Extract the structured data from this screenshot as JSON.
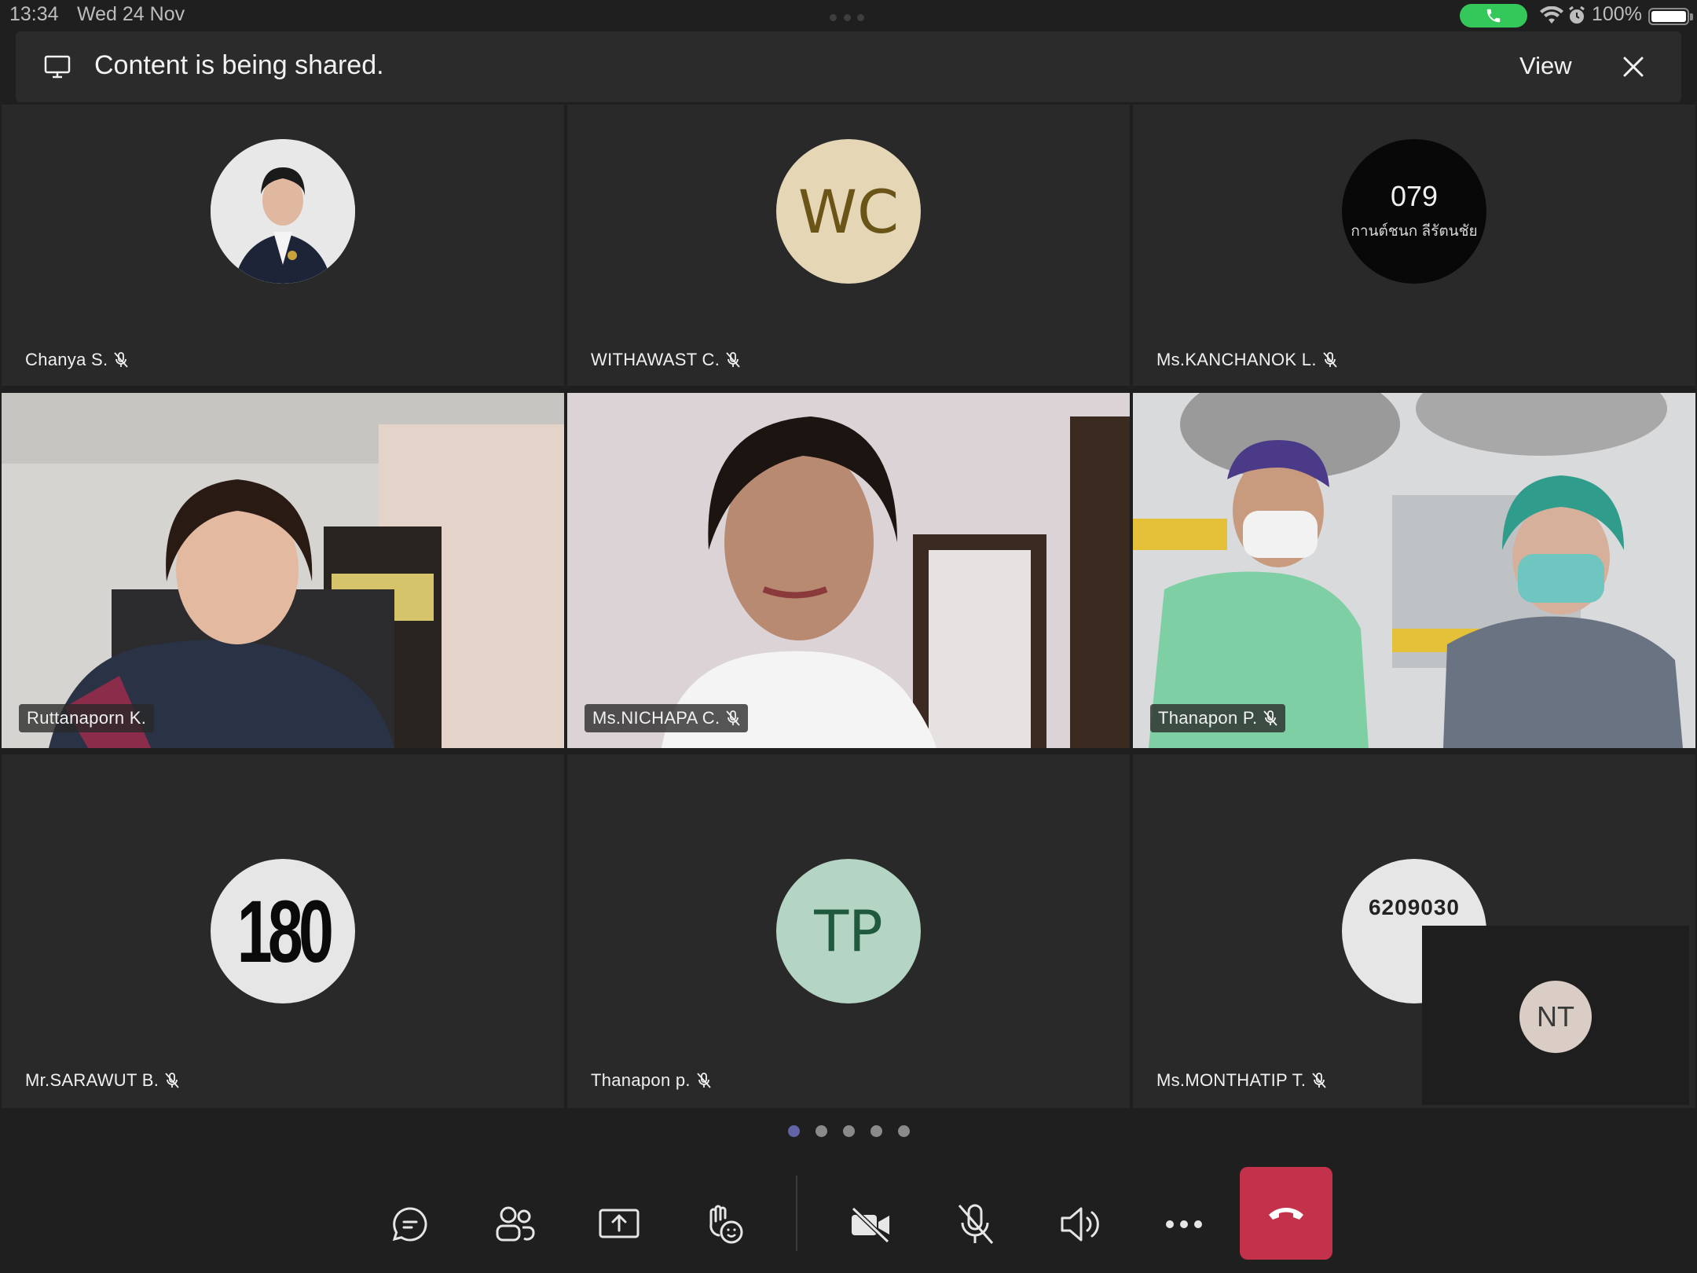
{
  "status_bar": {
    "time": "13:34",
    "date": "Wed 24 Nov",
    "battery": "100%"
  },
  "banner": {
    "text": "Content is being shared.",
    "view_label": "View",
    "icon": "monitor-icon"
  },
  "participants": [
    {
      "name": "Chanya S.",
      "avatar": "photo",
      "muted": true
    },
    {
      "name": "WITHAWAST C.",
      "initials": "WC",
      "muted": true
    },
    {
      "name": "Ms.KANCHANOK L.",
      "avatar_line1": "079",
      "avatar_line2": "กานต์ชนก ลีรัตนชัย",
      "muted": true
    },
    {
      "name": "Ruttanaporn K.",
      "video": true,
      "speaking": true,
      "muted": false
    },
    {
      "name": "Ms.NICHAPA C.",
      "video": true,
      "speaking": true,
      "muted": true
    },
    {
      "name": "Thanapon P.",
      "video": true,
      "muted": true
    },
    {
      "name": "Mr.SARAWUT B.",
      "avatar_text": "180",
      "muted": true
    },
    {
      "name": "Thanapon p.",
      "initials": "TP",
      "muted": true
    },
    {
      "name": "Ms.MONTHATIP T.",
      "avatar_text": "6209030",
      "muted": true
    }
  ],
  "self_view": {
    "initials": "NT"
  },
  "pager": {
    "pages": 5,
    "current": 1
  },
  "controls": [
    "chat-icon",
    "participants-icon",
    "share-icon",
    "reactions-icon",
    "camera-off-icon",
    "mic-off-icon",
    "speaker-icon",
    "more-icon",
    "hang-up-icon"
  ],
  "colors": {
    "accent": "#6264a7",
    "hangup": "#c4314b",
    "call_pill": "#34c759",
    "wc_avatar_bg": "#e5d7b6",
    "wc_avatar_fg": "#6b5417",
    "tp_avatar_bg": "#b4d4c4",
    "tp_avatar_fg": "#1f5a3f"
  }
}
